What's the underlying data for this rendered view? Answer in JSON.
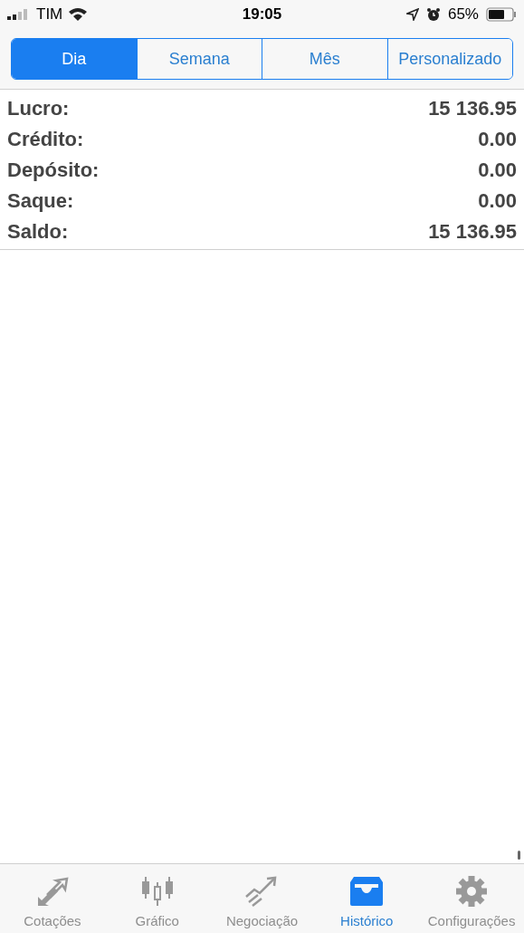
{
  "status_bar": {
    "carrier": "TIM",
    "time": "19:05",
    "battery": "65%"
  },
  "segments": [
    {
      "label": "Dia",
      "selected": true
    },
    {
      "label": "Semana",
      "selected": false
    },
    {
      "label": "Mês",
      "selected": false
    },
    {
      "label": "Personalizado",
      "selected": false
    }
  ],
  "summary": [
    {
      "label": "Lucro:",
      "value": "15 136.95"
    },
    {
      "label": "Crédito:",
      "value": "0.00"
    },
    {
      "label": "Depósito:",
      "value": "0.00"
    },
    {
      "label": "Saque:",
      "value": "0.00"
    },
    {
      "label": "Saldo:",
      "value": "15 136.95"
    }
  ],
  "tab_bar": [
    {
      "label": "Cotações",
      "kind": "quotes",
      "selected": false
    },
    {
      "label": "Gráfico",
      "kind": "chart",
      "selected": false
    },
    {
      "label": "Negociação",
      "kind": "trade",
      "selected": false
    },
    {
      "label": "Histórico",
      "kind": "history",
      "selected": true
    },
    {
      "label": "Configurações",
      "kind": "settings",
      "selected": false
    }
  ]
}
